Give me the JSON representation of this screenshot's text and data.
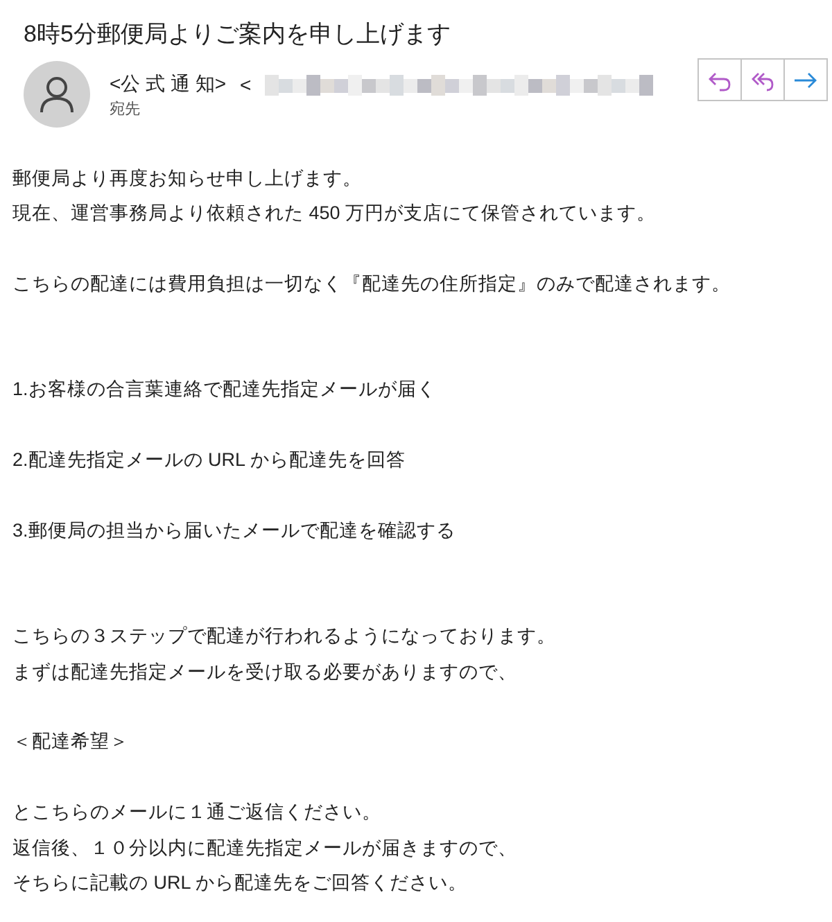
{
  "subject": "8時5分郵便局よりご案内を申し上げます",
  "sender": {
    "name": "<公 式 通 知>",
    "address_start": "<",
    "recipient_label": "宛先"
  },
  "actions": [
    {
      "kind": "reply"
    },
    {
      "kind": "reply_all"
    },
    {
      "kind": "forward"
    }
  ],
  "body": [
    {
      "kind": "lead",
      "lines": [
        "郵便局より再度お知らせ申し上げます。",
        "現在、運営事務局より依頼された 450 万円が支店にて保管されています。"
      ]
    },
    {
      "kind": "paragraph",
      "lines": [
        "こちらの配達には費用負担は一切なく『配達先の住所指定』のみで配達されます。"
      ]
    },
    {
      "kind": "section",
      "lines": [
        "1.お客様の合言葉連絡で配達先指定メールが届く"
      ]
    },
    {
      "kind": "paragraph",
      "lines": [
        "2.配達先指定メールの URL から配達先を回答"
      ]
    },
    {
      "kind": "paragraph",
      "lines": [
        "3.郵便局の担当から届いたメールで配達を確認する"
      ]
    },
    {
      "kind": "section",
      "lines": [
        "こちらの３ステップで配達が行われるようになっております。",
        "まずは配達先指定メールを受け取る必要がありますので、"
      ]
    },
    {
      "kind": "paragraph",
      "lines": [
        "＜配達希望＞"
      ]
    },
    {
      "kind": "paragraph",
      "lines": [
        "とこちらのメールに１通ご返信ください。",
        "返信後、１０分以内に配達先指定メールが届きますので、",
        "そちらに記載の URL から配達先をご回答ください。"
      ]
    }
  ]
}
